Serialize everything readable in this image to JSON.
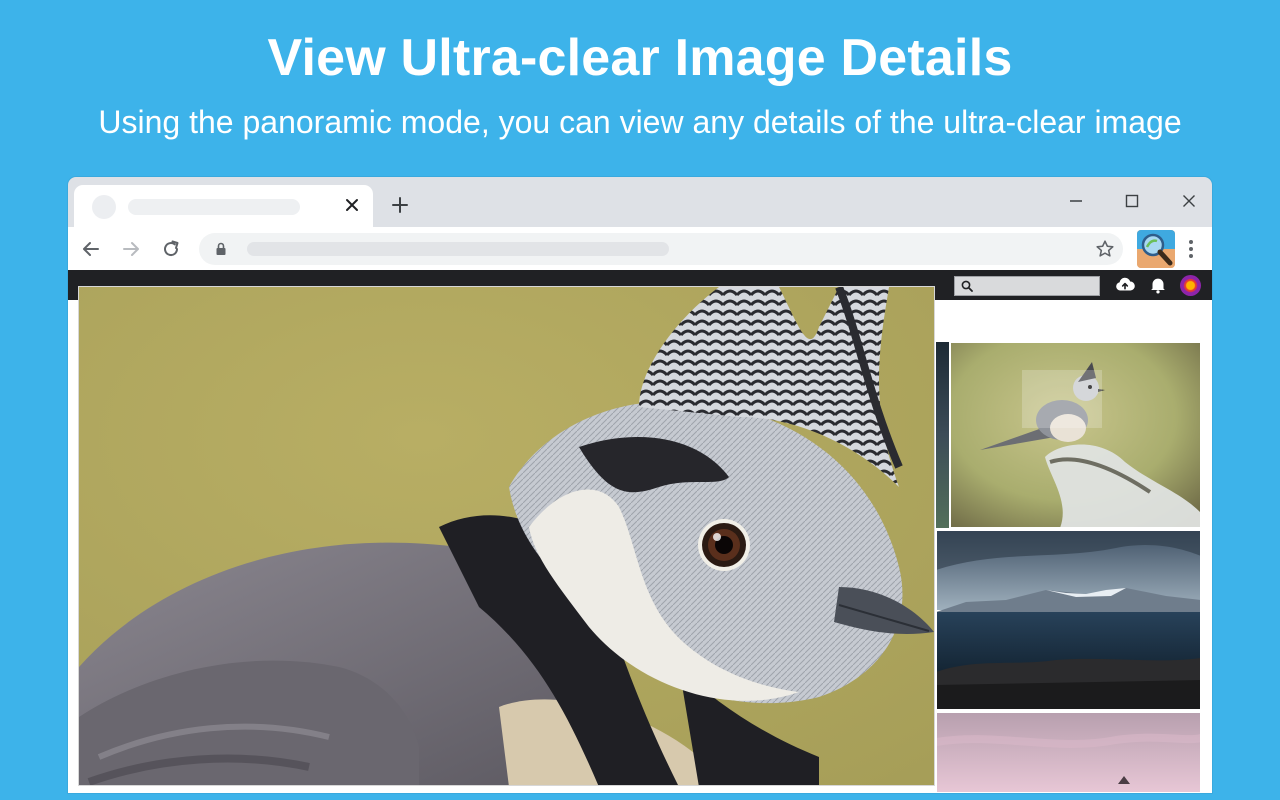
{
  "promo": {
    "headline": "View Ultra-clear Image Details",
    "subheadline": "Using the panoramic mode, you can view any details of the ultra-clear image"
  },
  "colors": {
    "background": "#3db3ea",
    "browser_frame": "#dee1e6",
    "site_header": "#202124",
    "extension_accent": "#e9a46b"
  },
  "icons": {
    "tab_close": "close-icon",
    "new_tab": "plus-icon",
    "back": "arrow-left-icon",
    "forward": "arrow-right-icon",
    "reload": "reload-icon",
    "lock": "lock-icon",
    "bookmark": "star-icon",
    "extension": "magnifier-icon",
    "menu": "kebab-menu-icon",
    "search": "search-icon",
    "upload": "cloud-upload-icon",
    "notifications": "bell-icon"
  }
}
